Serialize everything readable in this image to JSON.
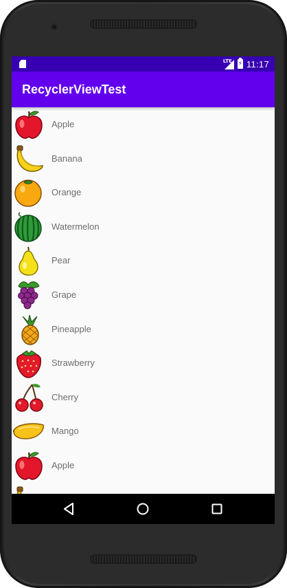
{
  "status_bar": {
    "time": "11:17",
    "network_label": "LTE",
    "left_icon": "sd-card-icon",
    "right_icons": [
      "lte-signal-icon",
      "battery-charging-icon"
    ]
  },
  "app_bar": {
    "title": "RecyclerViewTest"
  },
  "fruit_list": [
    {
      "name": "Apple",
      "icon": "apple-icon"
    },
    {
      "name": "Banana",
      "icon": "banana-icon"
    },
    {
      "name": "Orange",
      "icon": "orange-icon"
    },
    {
      "name": "Watermelon",
      "icon": "watermelon-icon"
    },
    {
      "name": "Pear",
      "icon": "pear-icon"
    },
    {
      "name": "Grape",
      "icon": "grape-icon"
    },
    {
      "name": "Pineapple",
      "icon": "pineapple-icon"
    },
    {
      "name": "Strawberry",
      "icon": "strawberry-icon"
    },
    {
      "name": "Cherry",
      "icon": "cherry-icon"
    },
    {
      "name": "Mango",
      "icon": "mango-icon"
    },
    {
      "name": "Apple",
      "icon": "apple-icon"
    }
  ],
  "nav_bar": {
    "buttons": [
      "back-icon",
      "home-icon",
      "recents-icon"
    ]
  },
  "colors": {
    "status_bar": "#3700b3",
    "app_bar": "#6200ee",
    "list_background": "#fafafa",
    "label_text": "#6d6d6d"
  }
}
